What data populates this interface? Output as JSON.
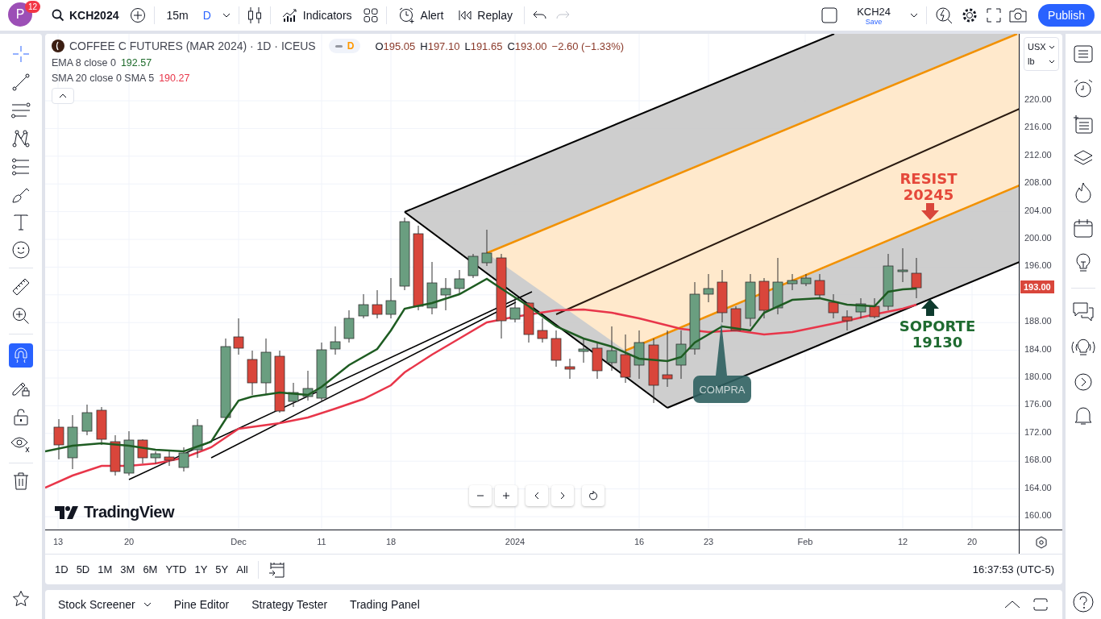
{
  "top_bar": {
    "avatar": "P",
    "notifications": "12",
    "symbol": "KCH2024",
    "interval": "15m",
    "chart_type": "D",
    "indicators": "Indicators",
    "alert": "Alert",
    "replay": "Replay",
    "redo_disabled": true,
    "layout_name": "KCH24",
    "layout_status": "Save",
    "publish": "Publish"
  },
  "toolbar": {
    "crosshair": {
      "selected": true
    },
    "magnet": {
      "on": true
    }
  },
  "legend": {
    "title": "COFFEE C FUTURES (MAR 2024) · 1D · ICEUS",
    "interval_badge": "D",
    "ohlc": [
      {
        "label": "O",
        "value": "195.05"
      },
      {
        "label": "H",
        "value": "197.10"
      },
      {
        "label": "L",
        "value": "191.65"
      },
      {
        "label": "C",
        "value": "193.00"
      }
    ],
    "change": "−2.60 (−1.33%)",
    "indicators": [
      {
        "name": "EMA 8 close 0",
        "value": "192.57",
        "color": "#1e6b2b"
      },
      {
        "name": "SMA 20 close 0 SMA 5",
        "value": "190.27",
        "color": "#e8364a"
      }
    ]
  },
  "annotations": [
    {
      "kind": "resist",
      "lines": [
        "RESIST",
        "20245"
      ]
    },
    {
      "kind": "support",
      "lines": [
        "SOPORTE",
        "19130"
      ]
    },
    {
      "kind": "callout",
      "lines": [
        "COMPRA"
      ]
    }
  ],
  "watermark": "TradingView",
  "price_axis": {
    "currency": "USX",
    "unit": "lb",
    "ticks": [
      "220.00",
      "216.00",
      "212.00",
      "208.00",
      "204.00",
      "200.00",
      "196.00",
      "188.00",
      "184.00",
      "180.00",
      "176.00",
      "172.00",
      "168.00",
      "164.00",
      "160.00"
    ],
    "last_price": "193.00"
  },
  "time_axis": [
    "13",
    "20",
    "Dec",
    "11",
    "18",
    "2024",
    "16",
    "23",
    "Feb",
    "12",
    "20"
  ],
  "ranges": [
    "1D",
    "5D",
    "1M",
    "3M",
    "6M",
    "YTD",
    "1Y",
    "5Y",
    "All"
  ],
  "clock": "16:37:53 (UTC-5)",
  "bottom_tabs": [
    {
      "label": "Stock Screener",
      "dropdown": true
    },
    {
      "label": "Pine Editor",
      "dropdown": false
    },
    {
      "label": "Strategy Tester",
      "dropdown": false
    },
    {
      "label": "Trading Panel",
      "dropdown": false
    }
  ]
}
